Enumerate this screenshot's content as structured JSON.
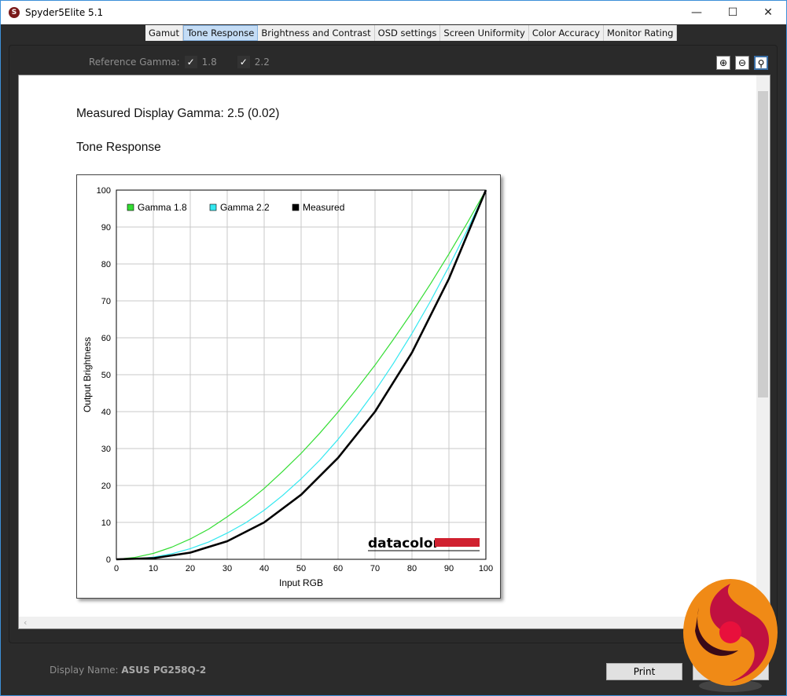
{
  "window": {
    "title": "Spyder5Elite 5.1",
    "controls": [
      "minimize",
      "maximize",
      "close"
    ]
  },
  "tabs": [
    {
      "label": "Gamut"
    },
    {
      "label": "Tone Response",
      "active": true
    },
    {
      "label": "Brightness and Contrast"
    },
    {
      "label": "OSD settings"
    },
    {
      "label": "Screen Uniformity"
    },
    {
      "label": "Color Accuracy"
    },
    {
      "label": "Monitor Rating"
    }
  ],
  "reference_gamma": {
    "label": "Reference Gamma:",
    "options": [
      {
        "value": "1.8",
        "checked": true
      },
      {
        "value": "2.2",
        "checked": true
      }
    ]
  },
  "zoom_tools": [
    "zoom-in-icon",
    "zoom-out-icon",
    "zoom-fit-icon"
  ],
  "report": {
    "measured": "Measured Display Gamma: 2.5 (0.02)",
    "section": "Tone Response"
  },
  "chart_data": {
    "type": "line",
    "xlabel": "Input RGB",
    "ylabel": "Output Brightness",
    "xlim": [
      0,
      100
    ],
    "ylim": [
      0,
      100
    ],
    "grid": true,
    "legend": "top-left",
    "xticks": [
      "0",
      "10",
      "20",
      "30",
      "40",
      "50",
      "60",
      "70",
      "80",
      "90",
      "100"
    ],
    "yticks": [
      "0",
      "10",
      "20",
      "30",
      "40",
      "50",
      "60",
      "70",
      "80",
      "90",
      "100"
    ],
    "series": [
      {
        "name": "Gamma 1.8",
        "color": "#33dd33",
        "x": [
          0,
          5,
          10,
          15,
          20,
          25,
          30,
          35,
          40,
          45,
          50,
          55,
          60,
          65,
          70,
          75,
          80,
          85,
          90,
          95,
          100
        ],
        "y": [
          0,
          0.5,
          1.6,
          3.3,
          5.5,
          8.2,
          11.5,
          15.1,
          19.2,
          23.8,
          28.7,
          34.1,
          39.9,
          46.1,
          52.6,
          59.6,
          66.9,
          74.6,
          82.7,
          91.2,
          100
        ]
      },
      {
        "name": "Gamma 2.2",
        "color": "#33e8f0",
        "x": [
          0,
          5,
          10,
          15,
          20,
          25,
          30,
          35,
          40,
          45,
          50,
          55,
          60,
          65,
          70,
          75,
          80,
          85,
          90,
          95,
          100
        ],
        "y": [
          0,
          0.1,
          0.6,
          1.5,
          2.9,
          4.7,
          7.1,
          9.9,
          13.3,
          17.3,
          21.8,
          26.8,
          32.5,
          38.8,
          45.6,
          53.1,
          61.2,
          69.9,
          79.3,
          89.3,
          100
        ]
      },
      {
        "name": "Measured",
        "color": "#000000",
        "x": [
          0,
          10,
          20,
          30,
          40,
          50,
          60,
          70,
          80,
          90,
          100
        ],
        "y": [
          0,
          0.3,
          1.8,
          4.9,
          10,
          17.5,
          27.5,
          40,
          56,
          76,
          100
        ]
      }
    ],
    "watermark": "datacolor"
  },
  "footer": {
    "display_label": "Display Name:",
    "display_name": "ASUS PG258Q-2",
    "print": "Print"
  }
}
